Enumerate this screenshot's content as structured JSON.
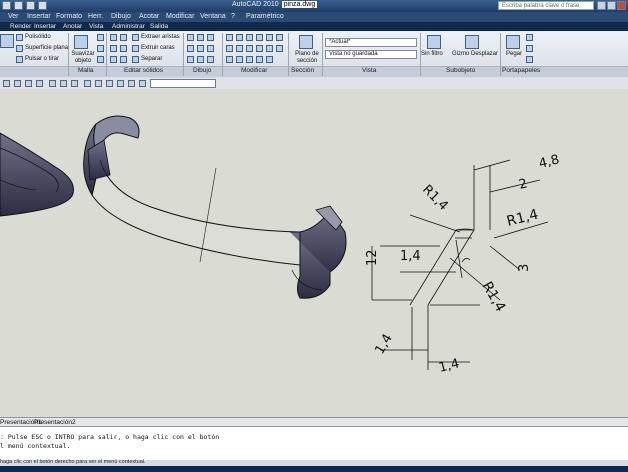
{
  "window": {
    "app_title": "AutoCAD 2010",
    "file_name": "pinza.dwg",
    "search_placeholder": "Escriba palabra clave o frase"
  },
  "menu": [
    "Ver",
    "Insertar",
    "Formato",
    "Herr.",
    "Dibujo",
    "Acotar",
    "Modificar",
    "Ventana",
    "?",
    "Paramétrico"
  ],
  "tabs": [
    "Render",
    "Insertar",
    "Anotar",
    "Vista",
    "Administrar",
    "Salida"
  ],
  "ribbon": {
    "solid_tools": [
      "Polisólido",
      "Superficie plana",
      "Pulsar o tirar"
    ],
    "mesh_tool": "Suavizar objeto",
    "edit_tools": [
      "Extraer aristas",
      "Extruir caras",
      "Separar"
    ],
    "section_tool": "Plano de sección",
    "view_combo": "*Actual*",
    "named_view": "Vista no guardada",
    "filter_tool": "Sin filtro",
    "gizmo_tool": "Gizmo Desplazar",
    "paste_tool": "Pegar",
    "panels": [
      "Malla",
      "Editar sólidos",
      "Dibujo",
      "Modificar",
      "Sección",
      "Vista",
      "Subobjeto",
      "Portapapeles"
    ]
  },
  "drawing": {
    "dimensions": [
      "4,8",
      "2",
      "R1,4",
      "R1,4",
      "1,4",
      "12",
      "3",
      "R1,4",
      "1,4",
      "1,4"
    ]
  },
  "layout_tabs": [
    "Presentación1",
    "Presentación2"
  ],
  "command": {
    "line1": ": Pulse ESC o INTRO para salir, o haga clic con el botón",
    "line2": "l menú contextual."
  },
  "status_text": "haga clic con el botón derecho para ver el menú contextual."
}
